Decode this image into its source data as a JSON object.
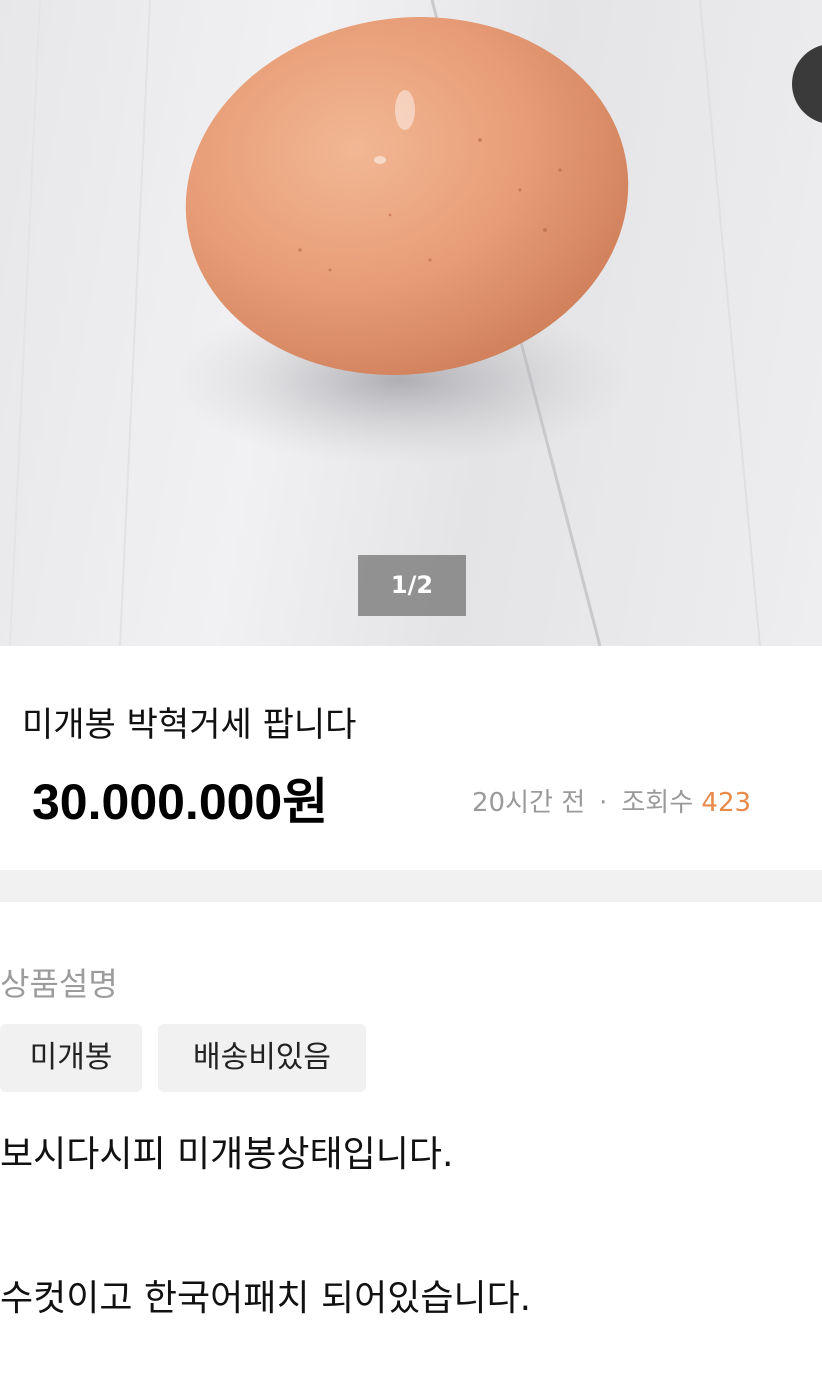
{
  "gallery": {
    "indicator": "1/2"
  },
  "listing": {
    "title": "미개봉 박혁거세 팝니다",
    "price": "30.000.000원",
    "posted_time": "20시간 전",
    "separator": "·",
    "views_label": "조회수",
    "views_count": "423"
  },
  "description": {
    "section_label": "상품설명",
    "tags": [
      "미개봉",
      "배송비있음"
    ],
    "lines": [
      "보시다시피 미개봉상태입니다.",
      "수컷이고 한국어패치 되어있습니다."
    ]
  },
  "colors": {
    "views_count": "#e88a4a",
    "egg": "#e9a07c",
    "floor": "#ececee"
  },
  "icons": {
    "side_button": "circle-button"
  }
}
